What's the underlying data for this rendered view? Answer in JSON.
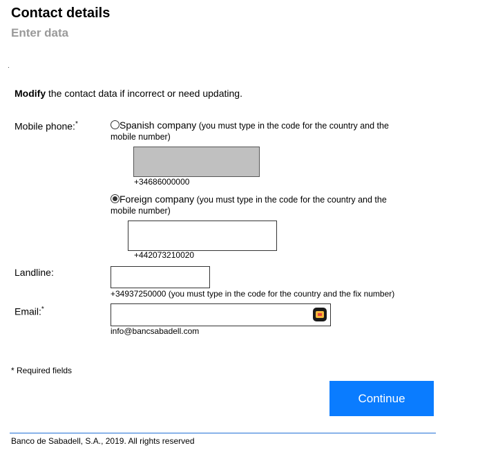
{
  "header": {
    "title": "Contact details",
    "subtitle": "Enter data"
  },
  "intro": {
    "bold": "Modify",
    "text": " the contact data if incorrect or need updating."
  },
  "mobile": {
    "label": "Mobile phone:",
    "required_mark": "*",
    "spanish_option": {
      "label": "Spanish company",
      "hint_line1": " (you must type in the code for the country and the",
      "hint_line2": "mobile number)",
      "selected": false,
      "value": "",
      "example": "+34686000000"
    },
    "foreign_option": {
      "label": "Foreign company",
      "hint_line1": " (you must type in the code for the country and the",
      "hint_line2": "mobile number)",
      "selected": true,
      "value": "",
      "example": "+442073210020"
    }
  },
  "landline": {
    "label": "Landline:",
    "value": "",
    "hint": "+34937250000 (you must type in the code for the country and the fix number)"
  },
  "email": {
    "label": "Email:",
    "required_mark": "*",
    "value": "",
    "example": "info@bancsabadell.com",
    "autofill_icon": "autofill-icon"
  },
  "required_note": "* Required fields",
  "continue_button": "Continue",
  "colors": {
    "button": "#0a7cff",
    "footer_rule": "#1f6fd6",
    "subtitle": "#9a9a9a",
    "disabled_field": "#c0c0c0"
  },
  "footer": "Banco de Sabadell, S.A., 2019. All rights reserved"
}
